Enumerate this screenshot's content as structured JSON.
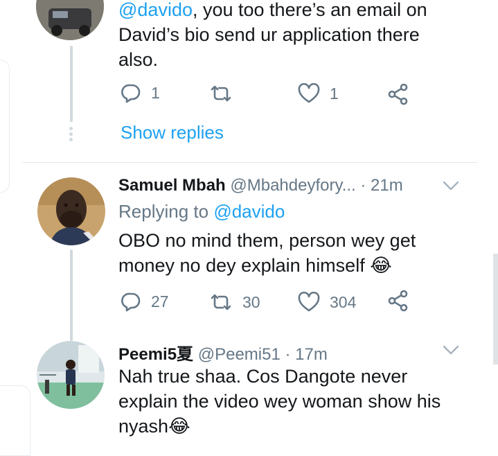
{
  "tweet1": {
    "mention": "@davido",
    "text_after_mention": ", you too there’s an email on",
    "line2": "David’s bio send ur application there",
    "line3": "also.",
    "stats": {
      "replies": "1",
      "retweets": "",
      "likes": "1"
    },
    "show_replies": "Show replies"
  },
  "tweet2": {
    "name": "Samuel Mbah",
    "handle_time": "@Mbahdeyfory... · 21m",
    "replying_prefix": "Replying to ",
    "replying_to": "@davido",
    "line1": "OBO no mind them, person wey get",
    "line2": "money no dey explain himself",
    "emoji": "😂",
    "stats": {
      "replies": "27",
      "retweets": "30",
      "likes": "304"
    }
  },
  "tweet3": {
    "name": "Peemi5夏",
    "handle_time": "@Peemi51 · 17m",
    "line1": "Nah true shaa. Cos Dangote never",
    "line2": "explain the video wey woman show his",
    "line3": "nyash",
    "emoji": "😂"
  },
  "colors": {
    "accent": "#1da1f2",
    "muted": "#657786",
    "thread": "#cfd9de"
  },
  "icons": [
    "reply-icon",
    "retweet-icon",
    "like-icon",
    "share-icon",
    "chevron-down-icon"
  ]
}
